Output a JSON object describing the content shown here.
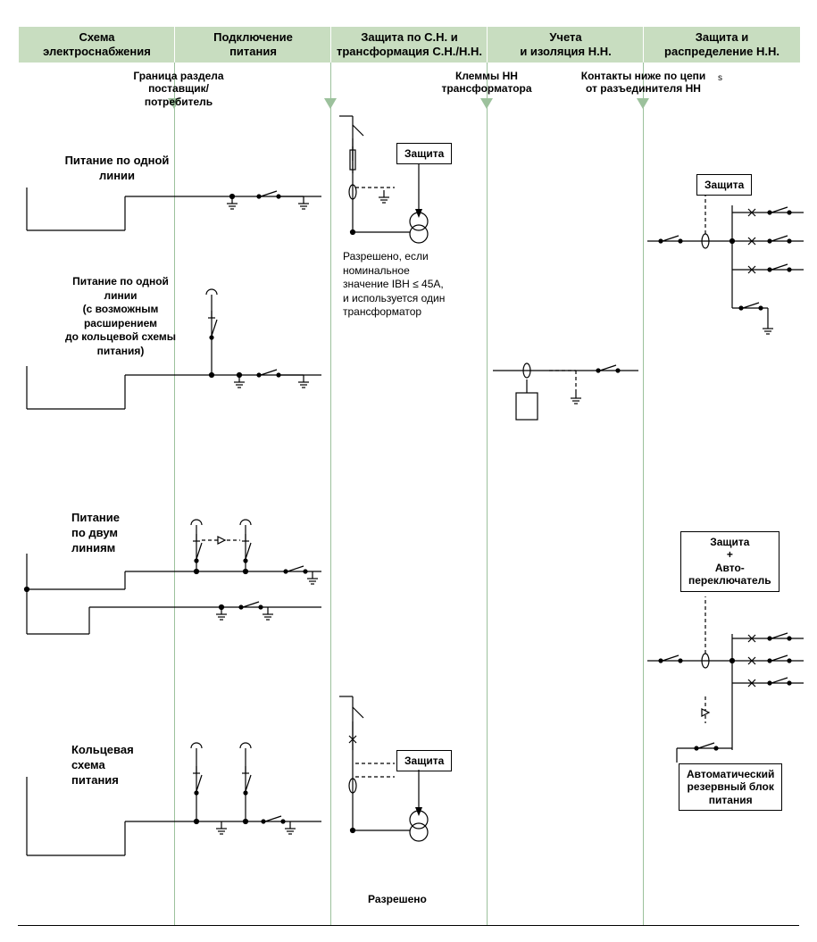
{
  "columns": {
    "c1": "Схема\nэлектроснабжения",
    "c2": "Подключение\nпитания",
    "c3": "Защита по С.Н. и\nтрансформация С.Н./Н.Н.",
    "c4": "Учета\nи изоляция Н.Н.",
    "c5": "Защита и\nраспределение Н.Н."
  },
  "sublabels": {
    "s1": "Граница раздела\nпоставщик/потребитель",
    "s2": "Клеммы НН\nтрансформатора",
    "s3": "Контакты ниже по цепи\nот разъединителя НН"
  },
  "rows": {
    "r1": "Питание по одной\nлинии",
    "r2": "Питание по одной\nлинии\n(с возможным\nрасширением\nдо кольцевой схемы\nпитания)",
    "r3": "Питание\nпо двум\nлиниям",
    "r4": "Кольцевая\nсхема\nпитания"
  },
  "boxes": {
    "prot": "Защита",
    "prot_auto": "Защита\n+\nАвто-\nпереключатель",
    "backup": "Автоматический\nрезервный блок\nпитания"
  },
  "notes": {
    "note1": "Разрешено, если\nноминальное\nзначение IВН ≤ 45А,\nи используется один\nтрансформатор",
    "note2": "Разрешено"
  },
  "super_s": "s"
}
